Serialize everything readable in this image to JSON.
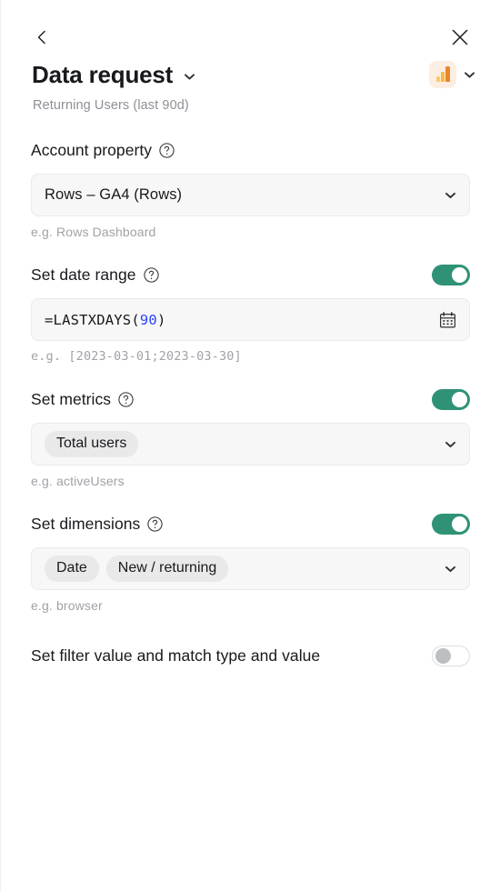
{
  "topbar": {
    "back_icon": "chevron-left-icon",
    "close_icon": "close-icon"
  },
  "header": {
    "title": "Data request",
    "title_caret_icon": "chevron-down-icon",
    "subtitle": "Returning Users (last 90d)",
    "source_icon": "google-analytics-icon",
    "source_caret_icon": "chevron-down-icon"
  },
  "colors": {
    "toggle_on": "#2f9277",
    "toggle_off_knob": "#bcbec2",
    "field_bg": "#f7f7f7",
    "chip_bg": "#e9e9ea",
    "formula_number": "#2b44ff",
    "ga_badge_bg": "#fdeee3",
    "ga_bar_light": "#f9cb5f",
    "ga_bar_mid": "#f6bb42",
    "ga_bar_dark": "#e8862e"
  },
  "sections": {
    "account_property": {
      "label": "Account property",
      "help_icon": "question-circle-icon",
      "value": "Rows – GA4 (Rows)",
      "caret_icon": "chevron-down-icon",
      "hint": "e.g. Rows Dashboard"
    },
    "date_range": {
      "label": "Set date range",
      "help_icon": "question-circle-icon",
      "toggle_state": "on",
      "formula_prefix": "=LASTXDAYS(",
      "formula_number": "90",
      "formula_suffix": ")",
      "calendar_icon": "calendar-icon",
      "hint": "e.g. [2023-03-01;2023-03-30]"
    },
    "metrics": {
      "label": "Set metrics",
      "help_icon": "question-circle-icon",
      "toggle_state": "on",
      "chips": [
        "Total users"
      ],
      "caret_icon": "chevron-down-icon",
      "hint": "e.g. activeUsers"
    },
    "dimensions": {
      "label": "Set dimensions",
      "help_icon": "question-circle-icon",
      "toggle_state": "on",
      "chips": [
        "Date",
        "New / returning"
      ],
      "caret_icon": "chevron-down-icon",
      "hint": "e.g. browser"
    },
    "filter": {
      "label": "Set filter value and match type and value",
      "toggle_state": "off"
    }
  }
}
